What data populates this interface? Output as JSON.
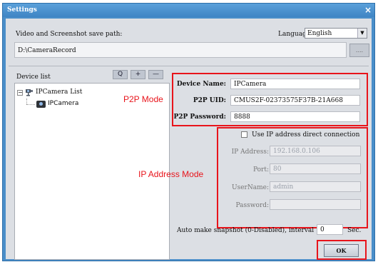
{
  "window": {
    "title": "Settings",
    "close_glyph": "×"
  },
  "top": {
    "path_label": "Video and Screenshot save path:",
    "path_value": "D:\\CameraRecord",
    "browse_label": "....",
    "language_label": "Language",
    "language_value": "English"
  },
  "device_list": {
    "label": "Device list",
    "search_glyph": "Q",
    "add_glyph": "+",
    "remove_glyph": "—",
    "root_label": "IPCamera List",
    "child_label": "IPCamera"
  },
  "annotations": {
    "p2p_mode": "P2P Mode",
    "ip_mode": "IP Address Mode"
  },
  "p2p": {
    "device_name_label": "Device Name:",
    "device_name_value": "IPCamera",
    "uid_label": "P2P UID:",
    "uid_value": "CMUS2F-02373575F37B-21A668",
    "password_label": "P2P Password:",
    "password_value": "8888"
  },
  "ip": {
    "checkbox_label": "Use IP address direct connection",
    "address_label": "IP Address:",
    "address_value": "192.168.0.106",
    "port_label": "Port:",
    "port_value": "80",
    "username_label": "UserName:",
    "username_value": "admin",
    "password_label": "Password:",
    "password_value": ""
  },
  "snapshot": {
    "label": "Auto make snapshot (0-Disabled), interval",
    "value": "0",
    "unit": "Sec."
  },
  "buttons": {
    "ok_label": "OK"
  },
  "colors": {
    "titlebar": "#4a8ec9",
    "annotation_red": "#e8141b",
    "client_bg": "#dcdfe4"
  }
}
